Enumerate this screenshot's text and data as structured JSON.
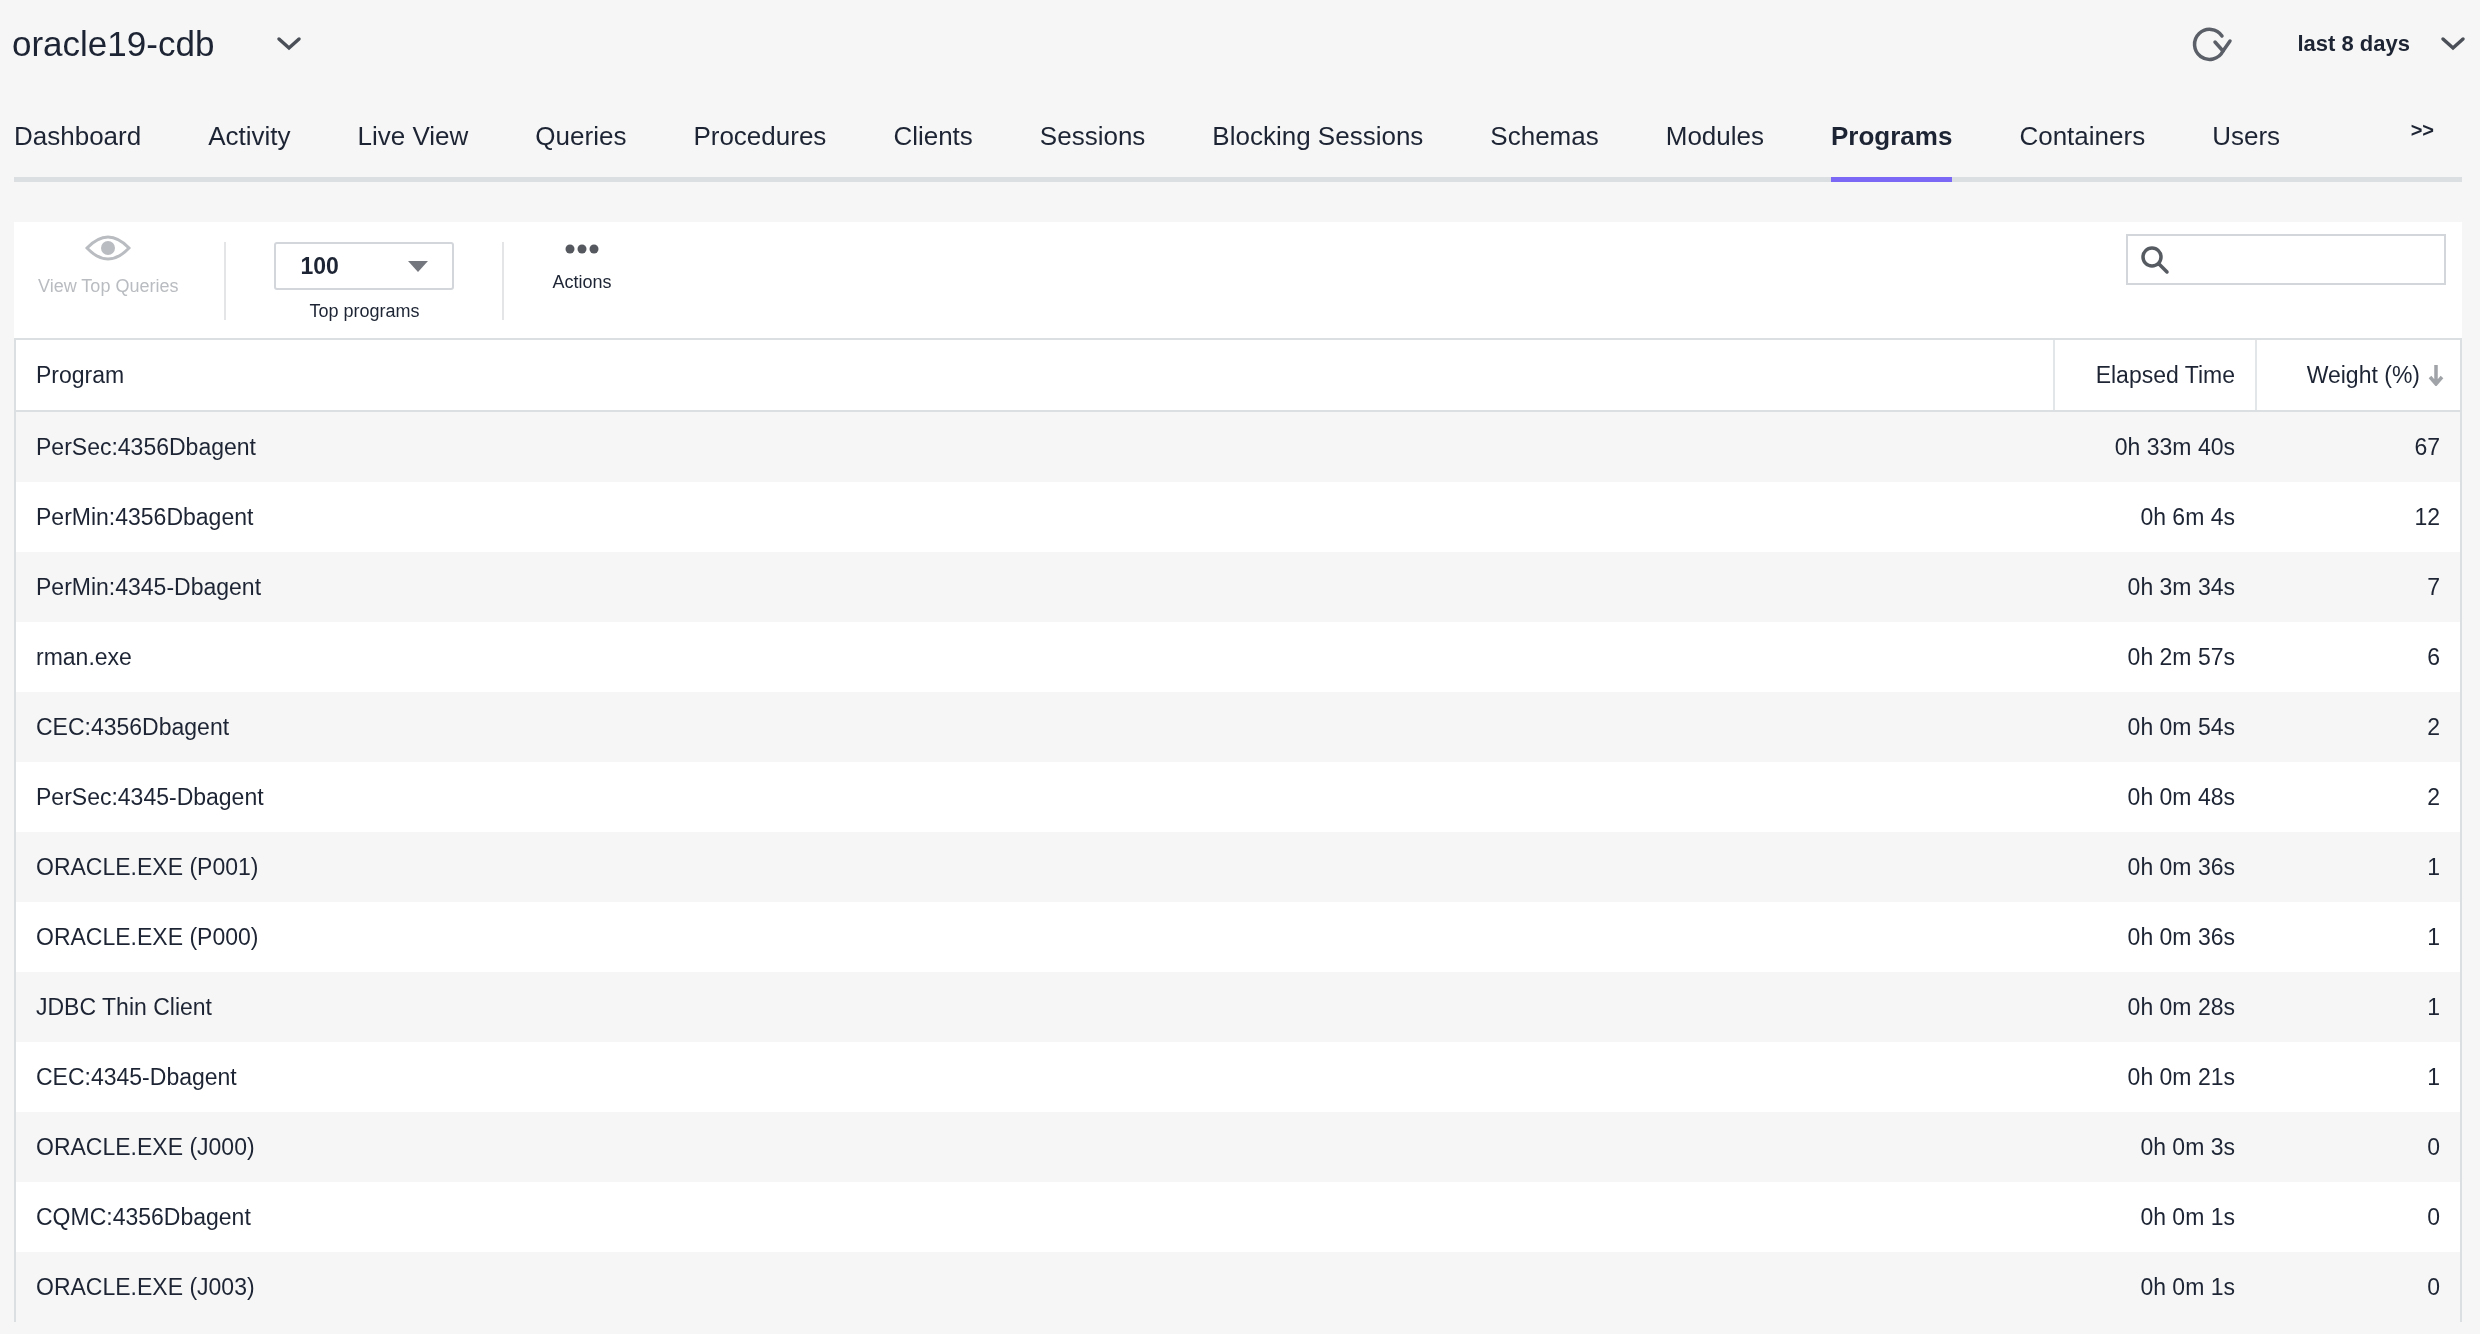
{
  "header": {
    "title": "oracle19-cdb",
    "time_range": "last 8 days"
  },
  "tabs": [
    {
      "label": "Dashboard",
      "selected": false
    },
    {
      "label": "Activity",
      "selected": false
    },
    {
      "label": "Live View",
      "selected": false
    },
    {
      "label": "Queries",
      "selected": false
    },
    {
      "label": "Procedures",
      "selected": false
    },
    {
      "label": "Clients",
      "selected": false
    },
    {
      "label": "Sessions",
      "selected": false
    },
    {
      "label": "Blocking Sessions",
      "selected": false
    },
    {
      "label": "Schemas",
      "selected": false
    },
    {
      "label": "Modules",
      "selected": false
    },
    {
      "label": "Programs",
      "selected": true
    },
    {
      "label": "Containers",
      "selected": false
    },
    {
      "label": "Users",
      "selected": false
    }
  ],
  "more_tabs": ">>",
  "toolbar": {
    "view_top_queries": {
      "label": "View Top Queries",
      "disabled": true
    },
    "top_select": {
      "value": "100",
      "label": "Top programs"
    },
    "actions": {
      "label": "Actions"
    }
  },
  "table": {
    "columns": [
      {
        "label": "Program",
        "sorted": false
      },
      {
        "label": "Elapsed Time",
        "sorted": false
      },
      {
        "label": "Weight (%)",
        "sorted": true
      }
    ],
    "rows": [
      [
        "PerSec:4356Dbagent",
        "0h 33m 40s",
        "67"
      ],
      [
        "PerMin:4356Dbagent",
        "0h 6m 4s",
        "12"
      ],
      [
        "PerMin:4345-Dbagent",
        "0h 3m 34s",
        "7"
      ],
      [
        "rman.exe",
        "0h 2m 57s",
        "6"
      ],
      [
        "CEC:4356Dbagent",
        "0h 0m 54s",
        "2"
      ],
      [
        "PerSec:4345-Dbagent",
        "0h 0m 48s",
        "2"
      ],
      [
        "ORACLE.EXE (P001)",
        "0h 0m 36s",
        "1"
      ],
      [
        "ORACLE.EXE (P000)",
        "0h 0m 36s",
        "1"
      ],
      [
        "JDBC Thin Client",
        "0h 0m 28s",
        "1"
      ],
      [
        "CEC:4345-Dbagent",
        "0h 0m 21s",
        "1"
      ],
      [
        "ORACLE.EXE (J000)",
        "0h 0m 3s",
        "0"
      ],
      [
        "CQMC:4356Dbagent",
        "0h 0m 1s",
        "0"
      ],
      [
        "ORACLE.EXE (J003)",
        "0h 0m 1s",
        "0"
      ]
    ]
  }
}
